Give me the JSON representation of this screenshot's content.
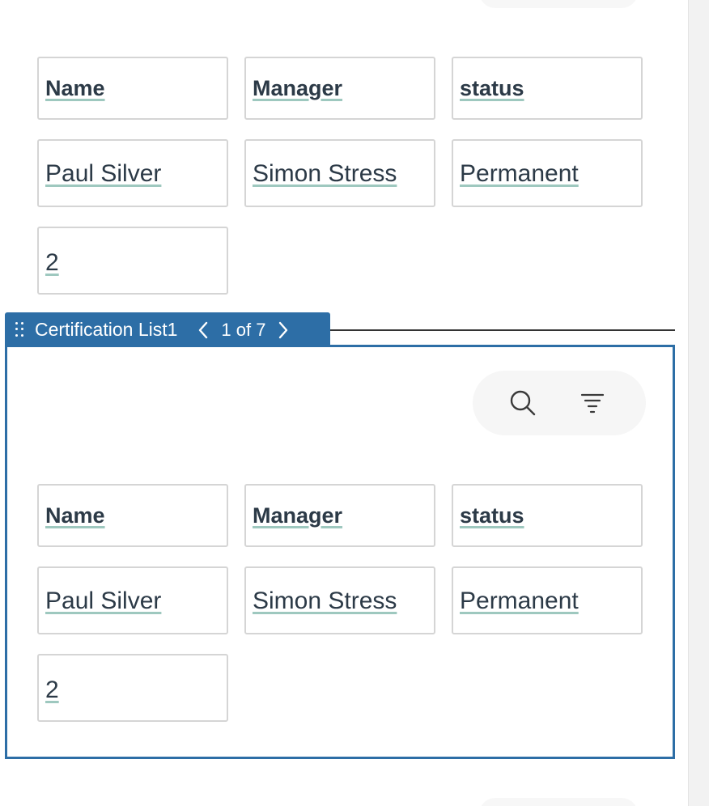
{
  "list_top": {
    "headers": [
      "Name",
      "Manager",
      "status"
    ],
    "row": [
      "Paul Silver",
      "Simon Stress",
      "Permanent"
    ],
    "number": "2"
  },
  "component": {
    "title": "Certification List1",
    "pager": "1 of 7",
    "accent_color": "#2d6ea6",
    "icons": [
      "drag-handle-icon",
      "chevron-left-icon",
      "chevron-right-icon",
      "search-icon",
      "filter-icon"
    ]
  },
  "list_bottom": {
    "headers": [
      "Name",
      "Manager",
      "status"
    ],
    "row": [
      "Paul Silver",
      "Simon Stress",
      "Permanent"
    ],
    "number": "2"
  }
}
